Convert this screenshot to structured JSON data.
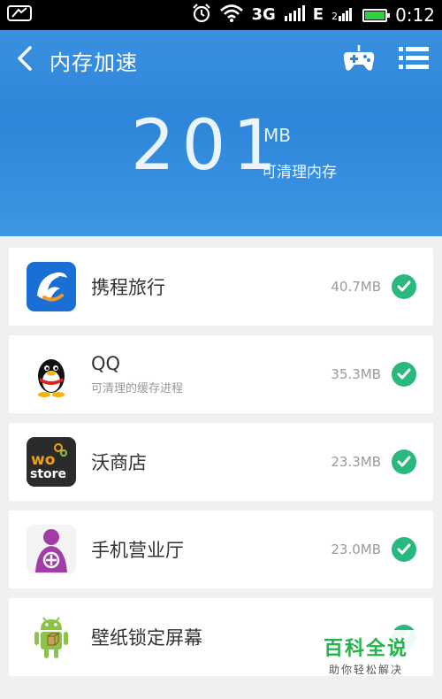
{
  "status_bar": {
    "network_type": "3G",
    "network_type_2": "E",
    "time": "0:12",
    "icons": [
      "signal-status-icon",
      "alarm-icon",
      "wifi-icon",
      "cellular-signal-icon",
      "battery-icon"
    ]
  },
  "header": {
    "title": "内存加速",
    "back_icon": "back-arrow-icon",
    "game_icon": "gamepad-icon",
    "menu_icon": "menu-icon",
    "amount": "201",
    "unit": "MB",
    "subtitle": "可清理内存"
  },
  "apps": [
    {
      "name": "携程旅行",
      "subtitle": "",
      "size": "40.7MB",
      "icon": "ctrip-dolphin-icon",
      "checked": true
    },
    {
      "name": "QQ",
      "subtitle": "可清理的缓存进程",
      "size": "35.3MB",
      "icon": "qq-penguin-icon",
      "checked": true
    },
    {
      "name": "沃商店",
      "subtitle": "",
      "size": "23.3MB",
      "icon": "wo-store-icon",
      "checked": true
    },
    {
      "name": "手机营业厅",
      "subtitle": "",
      "size": "23.0MB",
      "icon": "unicom-hall-icon",
      "checked": true
    },
    {
      "name": "壁纸锁定屏幕",
      "subtitle": "",
      "size": "",
      "icon": "android-robot-icon",
      "checked": true
    }
  ],
  "watermark": {
    "title": "百科全说",
    "subtitle": "助你轻松解决"
  },
  "colors": {
    "header_blue": "#2e86da",
    "check_green": "#29b97e",
    "watermark_green": "#24b34b"
  }
}
